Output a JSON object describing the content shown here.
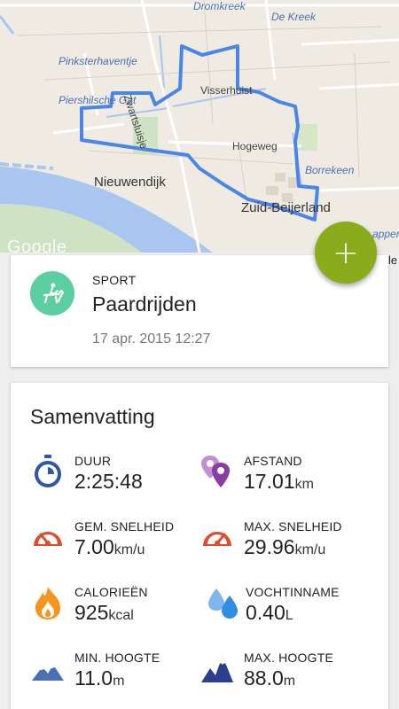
{
  "map": {
    "labels": {
      "dromkreek": "Dromkreek",
      "de_kreek": "De Kreek",
      "pinksterhaventje": "Pinksterhaventje",
      "piershilsche_gat": "Piershilsche Gat",
      "zwartsluisje": "Zwartsluisje",
      "visserhuist": "Visserhuist",
      "hogeweg": "Hogeweg",
      "borrekeen": "Borrekeen",
      "nieuwendijk": "Nieuwendijk",
      "zuid_beijerland": "Zuid-Beijerland",
      "appers": "appers"
    },
    "attribution": "Google",
    "route_color": "#4a86e8"
  },
  "fab": {
    "label": "+",
    "color": "#8aab1c"
  },
  "edge_letter": "le",
  "sport": {
    "label": "SPORT",
    "name": "Paardrijden",
    "date": "17 apr. 2015 12:27",
    "icon": "horse-riding-icon",
    "icon_color": "#5ccfa0"
  },
  "summary": {
    "title": "Samenvatting",
    "stats": [
      {
        "key": "duration",
        "label": "DUUR",
        "value": "2:25:48",
        "unit": "",
        "icon": "stopwatch-icon",
        "color": "#2f56a8"
      },
      {
        "key": "distance",
        "label": "AFSTAND",
        "value": "17.01",
        "unit": "km",
        "icon": "location-pins-icon",
        "color": "#8a3ca0"
      },
      {
        "key": "avg_speed",
        "label": "GEM. SNELHEID",
        "value": "7.00",
        "unit": "km/u",
        "icon": "speedometer-icon",
        "color": "#e3492b"
      },
      {
        "key": "max_speed",
        "label": "MAX. SNELHEID",
        "value": "29.96",
        "unit": "km/u",
        "icon": "speedometer-max-icon",
        "color": "#e3492b"
      },
      {
        "key": "calories",
        "label": "CALORIEËN",
        "value": "925",
        "unit": "kcal",
        "icon": "flame-icon",
        "color": "#f7941d"
      },
      {
        "key": "hydration",
        "label": "VOCHTINNAME",
        "value": "0.40",
        "unit": "L",
        "icon": "water-drops-icon",
        "color": "#2f8de4"
      },
      {
        "key": "min_altitude",
        "label": "MIN. HOOGTE",
        "value": "11.0",
        "unit": "m",
        "icon": "mountain-low-icon",
        "color": "#4a6fb5"
      },
      {
        "key": "max_altitude",
        "label": "MAX. HOOGTE",
        "value": "88.0",
        "unit": "m",
        "icon": "mountain-high-icon",
        "color": "#2c3f8f"
      }
    ]
  }
}
